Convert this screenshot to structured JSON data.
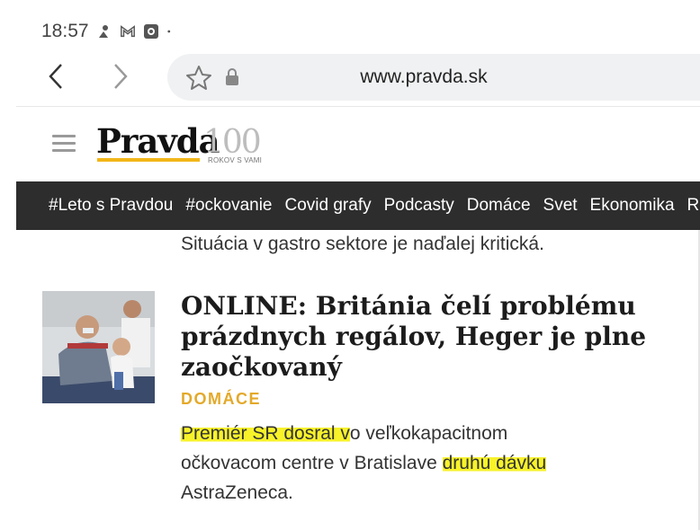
{
  "status_bar": {
    "time": "18:57",
    "icons": [
      "steam-notification-icon",
      "gmail-icon",
      "photo-app-icon",
      "dot-icon"
    ]
  },
  "browser": {
    "url": "www.pravda.sk",
    "back_icon": "chevron-left-icon",
    "forward_icon": "chevron-right-icon",
    "bookmark_icon": "star-icon",
    "lock_icon": "lock-icon"
  },
  "site": {
    "logo": "Pravda",
    "logo_100": "100",
    "logo_100_sub": "ROKOV S VAMI",
    "menu_icon": "hamburger-icon",
    "accent_color": "#f2b619"
  },
  "nav": {
    "items": [
      "#Leto s Pravdou",
      "#ockovanie",
      "Covid grafy",
      "Podcasty",
      "Domáce",
      "Svet",
      "Ekonomika",
      "R"
    ]
  },
  "article": {
    "previous_perex": "Situácia v gastro sektore je naďalej kritická.",
    "title": "ONLINE: Británia čelí problému prázdnych regálov, Heger je plne zaočkovaný",
    "category": "DOMÁCE",
    "category_color": "#e3a92a",
    "perex": {
      "highlight_1": "Premiér SR dosral v",
      "text_1": "o veľkokapacitnom očkovacom centre v Bratislave ",
      "highlight_2": "druhú dávku",
      "text_2": " AstraZeneca."
    },
    "highlight_color": "#f7f22a"
  }
}
